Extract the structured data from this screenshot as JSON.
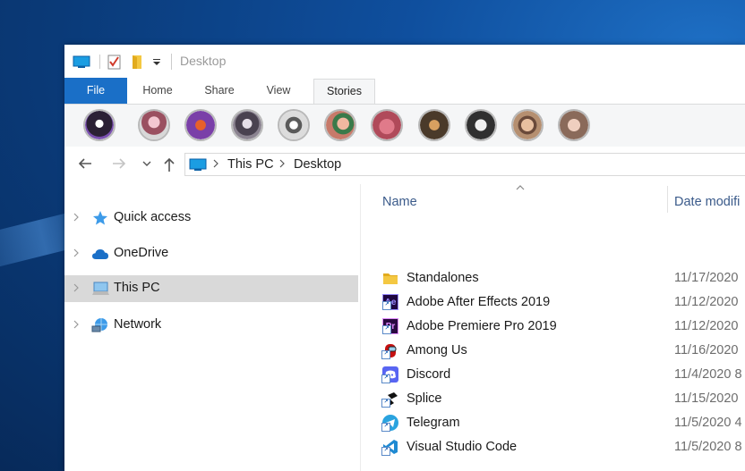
{
  "window": {
    "title": "Desktop"
  },
  "ribbon": {
    "tabs": [
      {
        "label": "File"
      },
      {
        "label": "Home"
      },
      {
        "label": "Share"
      },
      {
        "label": "View"
      },
      {
        "label": "Stories"
      }
    ]
  },
  "stories": [
    {
      "color": "#2b2035"
    },
    {
      "color": "#c8a8b8"
    },
    {
      "color": "#7a3fa8"
    },
    {
      "color": "#8b8390"
    },
    {
      "color": "#dcdcdc"
    },
    {
      "color": "#c77a6a"
    },
    {
      "color": "#b04a5a"
    },
    {
      "color": "#4a3a2a"
    },
    {
      "color": "#303030"
    },
    {
      "color": "#b58f70"
    },
    {
      "color": "#8a6a5a"
    }
  ],
  "address": {
    "crumbs": [
      "This PC",
      "Desktop"
    ]
  },
  "navpane": {
    "items": [
      {
        "label": "Quick access",
        "icon": "star-icon"
      },
      {
        "label": "OneDrive",
        "icon": "cloud-icon"
      },
      {
        "label": "This PC",
        "icon": "computer-icon"
      },
      {
        "label": "Network",
        "icon": "network-icon"
      }
    ]
  },
  "columns": {
    "name": "Name",
    "date": "Date modifi"
  },
  "files": [
    {
      "name": "Standalones",
      "date": "11/17/2020",
      "icon": "folder-icon"
    },
    {
      "name": "Adobe After Effects 2019",
      "date": "11/12/2020",
      "icon": "after-effects-icon"
    },
    {
      "name": "Adobe Premiere Pro 2019",
      "date": "11/12/2020",
      "icon": "premiere-pro-icon"
    },
    {
      "name": "Among Us",
      "date": "11/16/2020",
      "icon": "among-us-icon"
    },
    {
      "name": "Discord",
      "date": "11/4/2020 8",
      "icon": "discord-icon"
    },
    {
      "name": "Splice",
      "date": "11/15/2020",
      "icon": "splice-icon"
    },
    {
      "name": "Telegram",
      "date": "11/5/2020 4",
      "icon": "telegram-icon"
    },
    {
      "name": "Visual Studio Code",
      "date": "11/5/2020 8",
      "icon": "vscode-icon"
    }
  ]
}
